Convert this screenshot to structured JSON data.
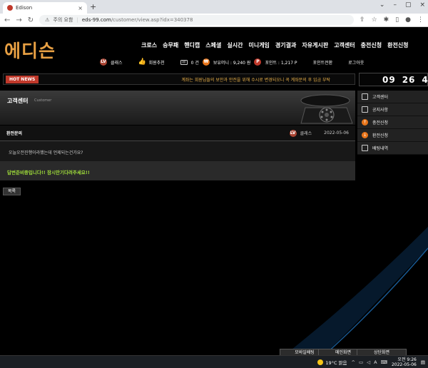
{
  "browser": {
    "tab_title": "Edison",
    "security_label": "주의 요함",
    "url_host": "eds-99.com",
    "url_path": "/customer/view.asp?idx=340378"
  },
  "site": {
    "logo": "에디슨",
    "nav": [
      "크로스",
      "승무패",
      "핸디캡",
      "스페셜",
      "실시간",
      "미니게임",
      "경기결과",
      "자유게시판",
      "고객센터",
      "충전신청",
      "환전신청"
    ],
    "user": {
      "level_icon": "LV",
      "name": "클래스",
      "recommend": "회원추천",
      "messages": "0 건",
      "money": "보유머니 : 9,240 원",
      "points": "포인트 : 1,217 P",
      "point_convert": "포인트전환",
      "logout": "로그아웃"
    },
    "hot": {
      "label": "HOT NEWS",
      "message": "계좌는 회원님들의 보안과 안전을 위해 수시로 변경되오니 꼭 계좌문의 후 입금 부탁"
    },
    "clock": {
      "h": "09",
      "m": "26",
      "s": "4"
    },
    "hero": {
      "title": "고객센터",
      "subtitle": "Customer"
    },
    "post": {
      "title": "환전문의",
      "author": "클래스",
      "date": "2022-05-06",
      "body": "오늘오전진행이라했는데 언제되는건가요?",
      "answer": "답변준비중입니다!! 잠시만기다려주세요!!"
    },
    "list_button": "목록",
    "side_menu": [
      {
        "label": "고객센터",
        "icon": "chat-icon"
      },
      {
        "label": "공지사항",
        "icon": "notice-icon"
      },
      {
        "label": "충전신청",
        "icon": "deposit-icon"
      },
      {
        "label": "환전신청",
        "icon": "withdraw-icon"
      },
      {
        "label": "배팅내역",
        "icon": "list-icon"
      }
    ],
    "bottom_buttons": [
      "모바일배팅",
      "메인화면",
      "상단화면"
    ]
  },
  "taskbar": {
    "weather": "19°C 맑음",
    "ime": "A",
    "time": "오전 9:26",
    "date": "2022-05-06"
  }
}
